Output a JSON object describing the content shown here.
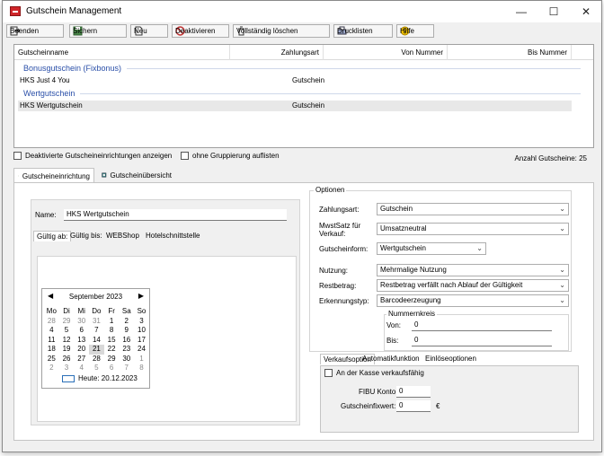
{
  "window": {
    "title": "Gutschein Management",
    "controls": {
      "minimize": "—",
      "maximize": "☐",
      "close": "✕"
    }
  },
  "toolbar": {
    "beenden": "Beenden",
    "sichern": "Sichern",
    "neu": "Neu",
    "deaktivieren": "Deaktivieren",
    "loeschen": "Vollständig löschen",
    "drucklisten": "Drucklisten",
    "hilfe": "Hilfe"
  },
  "list": {
    "columns": [
      "Gutscheinname",
      "Zahlungsart",
      "Von Nummer",
      "Bis Nummer"
    ],
    "groups": [
      {
        "title": "Bonusgutschein (Fixbonus)",
        "rows": [
          {
            "name": "HKS Just 4 You",
            "zahlungsart": "Gutschein"
          }
        ]
      },
      {
        "title": "Wertgutschein",
        "rows": [
          {
            "name": "HKS Wertgutschein",
            "zahlungsart": "Gutschein"
          }
        ]
      }
    ]
  },
  "options": {
    "show_deactivated": "Deaktivierte Gutscheineinrichtungen anzeigen",
    "no_grouping": "ohne Gruppierung auflisten",
    "count": "Anzahl Gutscheine: 25"
  },
  "tabs": {
    "einrichtung": "Gutscheineinrichtung",
    "uebersicht": "Gutscheinübersicht"
  },
  "form": {
    "name_label": "Name:",
    "name_value": "HKS Wertgutschein",
    "subtabs": [
      "Gültig ab:",
      "Gültig bis:",
      "WEBShop",
      "Hotelschnittstelle"
    ]
  },
  "calendar": {
    "month": "September 2023",
    "weekdays": [
      "Mo",
      "Di",
      "Mi",
      "Do",
      "Fr",
      "Sa",
      "So"
    ],
    "weeks": [
      [
        "28",
        "29",
        "30",
        "31",
        "1",
        "2",
        "3"
      ],
      [
        "4",
        "5",
        "6",
        "7",
        "8",
        "9",
        "10"
      ],
      [
        "11",
        "12",
        "13",
        "14",
        "15",
        "16",
        "17"
      ],
      [
        "18",
        "19",
        "20",
        "21",
        "22",
        "23",
        "24"
      ],
      [
        "25",
        "26",
        "27",
        "28",
        "29",
        "30",
        "1"
      ],
      [
        "2",
        "3",
        "4",
        "5",
        "6",
        "7",
        "8"
      ]
    ],
    "selected": "21",
    "today": "Heute: 20.12.2023"
  },
  "optionen": {
    "legend": "Optionen",
    "zahlungsart_label": "Zahlungsart:",
    "zahlungsart_value": "Gutschein",
    "mwst_label": "MwstSatz für Verkauf:",
    "mwst_value": "Umsatzneutral",
    "form_label": "Gutscheinform:",
    "form_value": "Wertgutschein",
    "nutzung_label": "Nutzung:",
    "nutzung_value": "Mehrmalige Nutzung",
    "restbetrag_label": "Restbetrag:",
    "restbetrag_value": "Restbetrag verfällt nach Ablauf der Gültigkeit",
    "erkennung_label": "Erkennungstyp:",
    "erkennung_value": "Barcodeerzeugung",
    "nummernkreis_legend": "Nummernkreis",
    "von_label": "Von:",
    "von_value": "0",
    "bis_label": "Bis:",
    "bis_value": "0"
  },
  "verkauf": {
    "tabs": [
      "Verkaufsoption",
      "Automatikfunktion",
      "Einlöseoptionen"
    ],
    "kasse": "An der Kasse verkaufsfähig",
    "fibu_label": "FIBU Konto:",
    "fibu_value": "0",
    "fixwert_label": "Gutscheinfixwert:",
    "fixwert_value": "0",
    "currency": "€"
  }
}
